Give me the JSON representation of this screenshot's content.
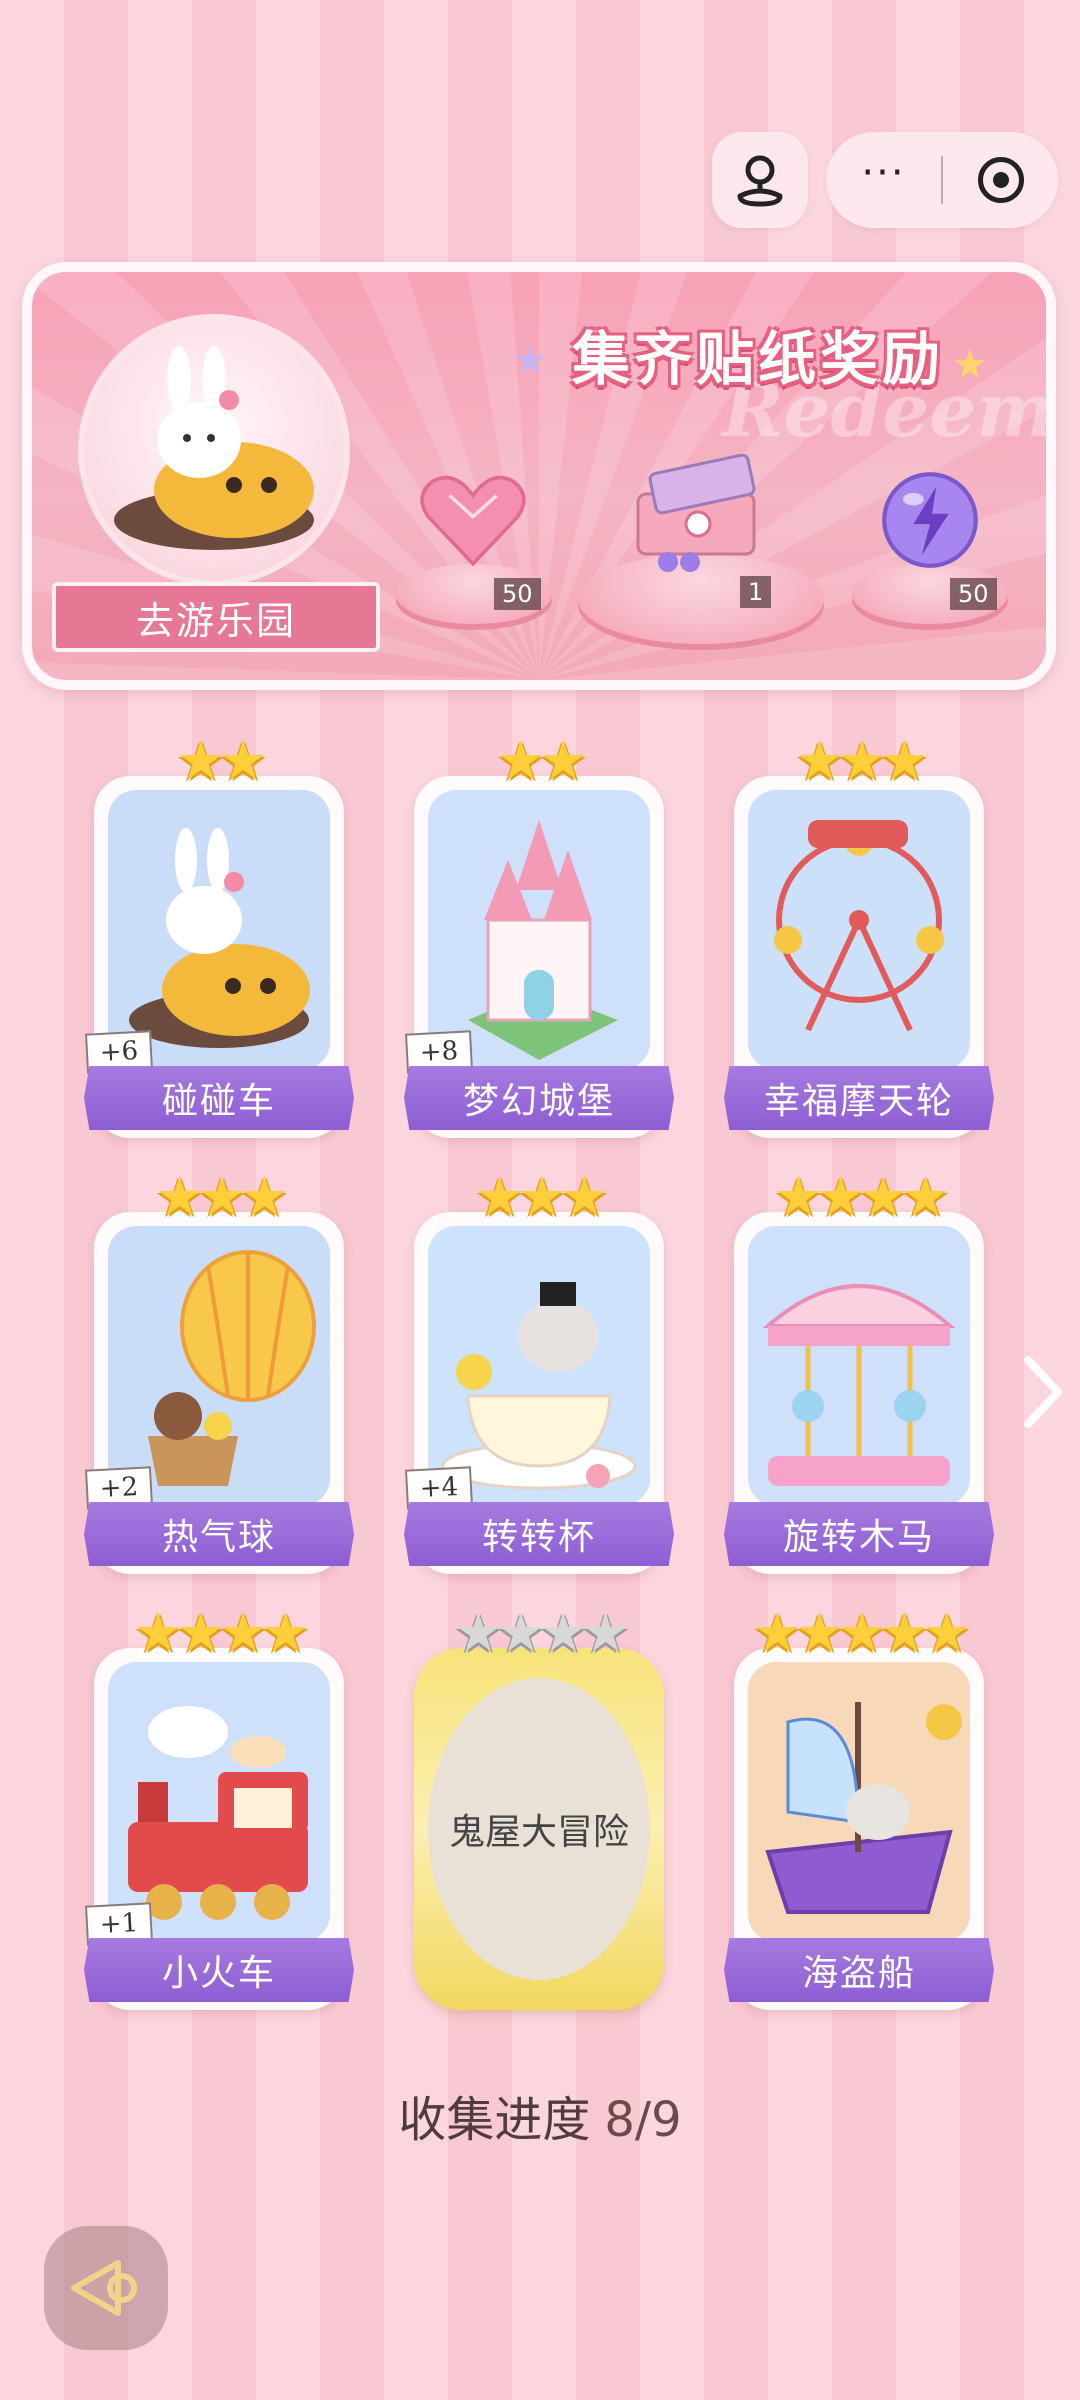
{
  "topbar": {
    "mini_icon": "game-controller-icon",
    "more_icon": "more-dots-icon",
    "more_glyph": "···",
    "close_icon": "target-close-icon"
  },
  "banner": {
    "title": "集齐贴纸奖励",
    "watermark": "Redeem",
    "goto_label": "去游乐园",
    "rewards": [
      {
        "name": "heart-gem",
        "count": "50"
      },
      {
        "name": "gift-box",
        "count": "1"
      },
      {
        "name": "lightning-orb",
        "count": "50"
      }
    ]
  },
  "cards": [
    {
      "label": "碰碰车",
      "stars": 2,
      "max_stars": 2,
      "plus": "+6",
      "theme": "bumper-car"
    },
    {
      "label": "梦幻城堡",
      "stars": 2,
      "max_stars": 2,
      "plus": "+8",
      "theme": "castle"
    },
    {
      "label": "幸福摩天轮",
      "stars": 3,
      "max_stars": 3,
      "plus": "",
      "theme": "ferris-wheel"
    },
    {
      "label": "热气球",
      "stars": 3,
      "max_stars": 3,
      "plus": "+2",
      "theme": "hot-air-balloon"
    },
    {
      "label": "转转杯",
      "stars": 3,
      "max_stars": 3,
      "plus": "+4",
      "theme": "teacup"
    },
    {
      "label": "旋转木马",
      "stars": 4,
      "max_stars": 4,
      "plus": "",
      "theme": "carousel"
    },
    {
      "label": "小火车",
      "stars": 4,
      "max_stars": 4,
      "plus": "+1",
      "theme": "train"
    },
    {
      "label": "鬼屋大冒险",
      "stars": 0,
      "max_stars": 4,
      "plus": "",
      "theme": "locked"
    },
    {
      "label": "海盗船",
      "stars": 5,
      "max_stars": 5,
      "plus": "",
      "theme": "pirate-ship"
    }
  ],
  "progress": {
    "label": "收集进度",
    "value": "8/9"
  },
  "colors": {
    "accent": "#e77895",
    "ribbon": "#9a6bd9",
    "star": "#ffcf3b"
  }
}
